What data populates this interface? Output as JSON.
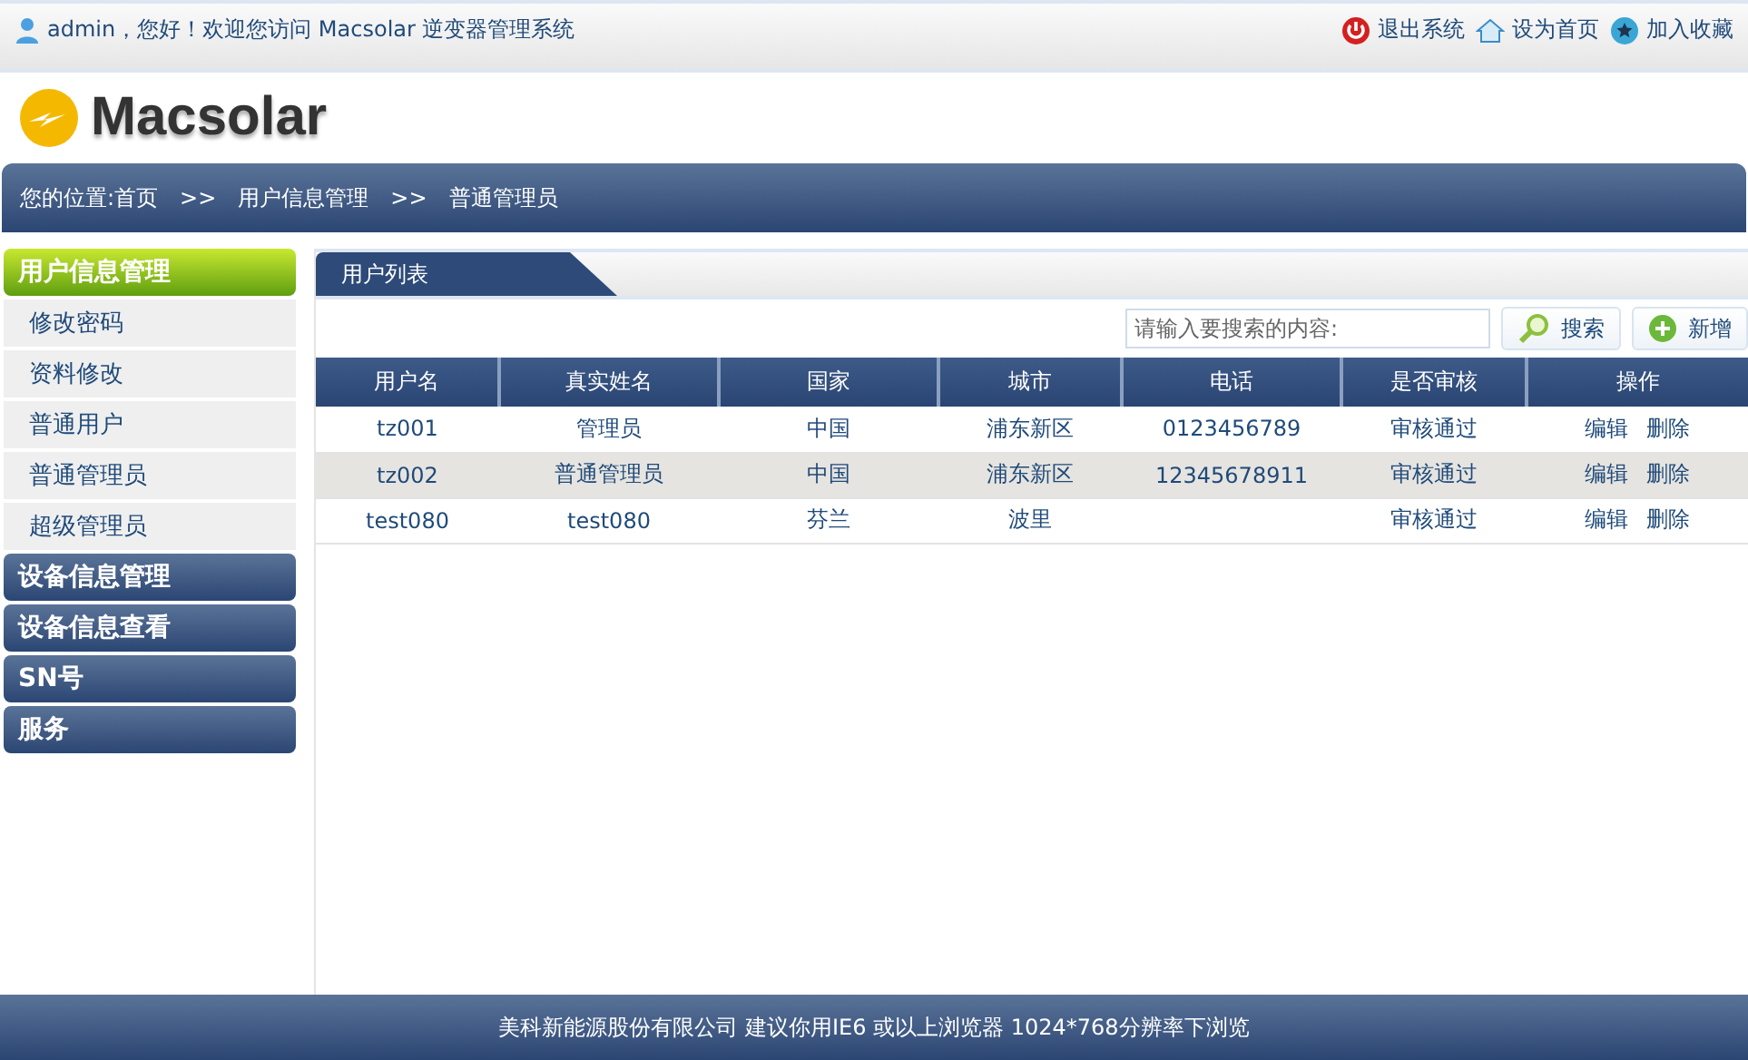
{
  "top_bar": {
    "greeting": "admin，您好！欢迎您访问 Macsolar 逆变器管理系统",
    "links": [
      {
        "kind": "logout",
        "label": "退出系统"
      },
      {
        "kind": "home",
        "label": "设为首页"
      },
      {
        "kind": "favorite",
        "label": "加入收藏"
      }
    ]
  },
  "logo": {
    "text": "Macsolar"
  },
  "breadcrumb": {
    "label": "您的位置:",
    "items": [
      "首页",
      "用户信息管理",
      "普通管理员"
    ],
    "separator": ">>"
  },
  "sidebar": [
    {
      "label": "用户信息管理",
      "expanded": true,
      "children": [
        "修改密码",
        "资料修改",
        "普通用户",
        "普通管理员",
        "超级管理员"
      ]
    },
    {
      "label": "设备信息管理",
      "expanded": false
    },
    {
      "label": "设备信息查看",
      "expanded": false
    },
    {
      "label": "SN号",
      "expanded": false
    },
    {
      "label": "服务",
      "expanded": false
    }
  ],
  "panel": {
    "tab": "用户列表",
    "search": {
      "placeholder": "请输入要搜索的内容:"
    },
    "buttons": [
      {
        "kind": "search",
        "label": "搜索"
      },
      {
        "kind": "add",
        "label": "新增"
      }
    ],
    "table": {
      "columns": [
        "用户名",
        "真实姓名",
        "国家",
        "城市",
        "电话",
        "是否审核",
        "操作"
      ],
      "rows": [
        {
          "username": "tz001",
          "real_name": "管理员",
          "country": "中国",
          "city": "浦东新区",
          "phone": "0123456789",
          "review": "审核通过",
          "actions": [
            "编辑",
            "删除"
          ]
        },
        {
          "username": "tz002",
          "real_name": "普通管理员",
          "country": "中国",
          "city": "浦东新区",
          "phone": "12345678911",
          "review": "审核通过",
          "actions": [
            "编辑",
            "删除"
          ]
        },
        {
          "username": "test080",
          "real_name": "test080",
          "country": "芬兰",
          "city": "波里",
          "review": "审核通过",
          "actions": [
            "编辑",
            "删除"
          ]
        }
      ]
    }
  },
  "footer": "美科新能源股份有限公司 建议你用IE6 或以上浏览器 1024*768分辨率下浏览"
}
